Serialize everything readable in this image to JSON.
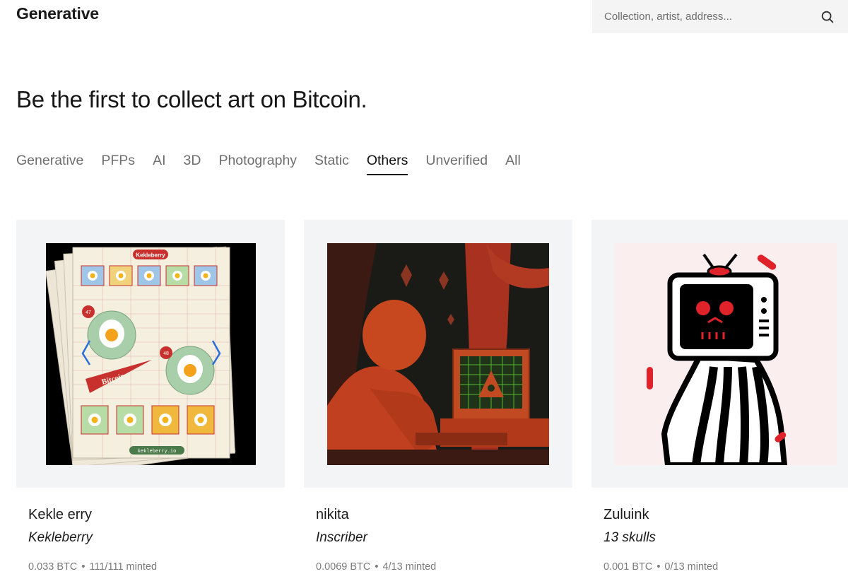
{
  "header": {
    "logo": "Generative",
    "search_placeholder": "Collection, artist, address..."
  },
  "headline": "Be the first to collect art on Bitcoin.",
  "tabs": [
    {
      "label": "Generative",
      "active": false
    },
    {
      "label": "PFPs",
      "active": false
    },
    {
      "label": "AI",
      "active": false
    },
    {
      "label": "3D",
      "active": false
    },
    {
      "label": "Photography",
      "active": false
    },
    {
      "label": "Static",
      "active": false
    },
    {
      "label": "Others",
      "active": true
    },
    {
      "label": "Unverified",
      "active": false
    },
    {
      "label": "All",
      "active": false
    }
  ],
  "cards": [
    {
      "artist": "Kekle  erry",
      "collection": "Kekleberry",
      "price": "0.033 BTC",
      "minted": "111/111 minted",
      "art_text": [
        "Kekleberry",
        "Bitcoin",
        "kekleberry.io",
        "47",
        "48"
      ]
    },
    {
      "artist": "nikita",
      "collection": "Inscriber",
      "price": "0.0069 BTC",
      "minted": "4/13 minted"
    },
    {
      "artist": "Zuluink",
      "collection": "13 skulls",
      "price": "0.001 BTC",
      "minted": "0/13 minted"
    }
  ],
  "colors": {
    "accent": "#111111",
    "muted": "#6e6e6e",
    "card_bg": "#f3f4f6",
    "search_bg": "#f4f4f4"
  }
}
